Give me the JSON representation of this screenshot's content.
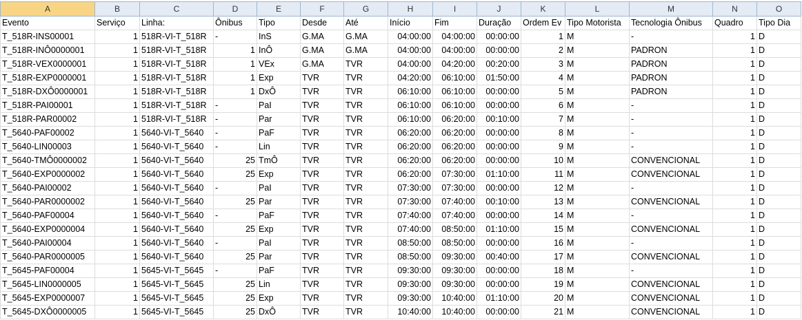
{
  "columns": [
    "A",
    "B",
    "C",
    "D",
    "E",
    "F",
    "G",
    "H",
    "I",
    "J",
    "K",
    "L",
    "M",
    "N",
    "O"
  ],
  "selected_column": "A",
  "header_row": [
    "Evento",
    "Serviço",
    "Linha:",
    "Ônibus",
    "Tipo",
    "Desde",
    "Até",
    "Início",
    "Fim",
    "Duração",
    "Ordem Ev",
    "Tipo Motorista",
    "Tecnologia Ônibus",
    "Quadro",
    "Tipo Dia"
  ],
  "rows": [
    [
      "T_518R-INS00001",
      "1",
      "518R-VI-T_518R",
      "-",
      "InS",
      "G.MA",
      "G.MA",
      "04:00:00",
      "04:00:00",
      "00:00:00",
      "1",
      "M",
      "-",
      "1",
      "D"
    ],
    [
      "T_518R-INÔ0000001",
      "1",
      "518R-VI-T_518R",
      "1",
      "InÔ",
      "G.MA",
      "G.MA",
      "04:00:00",
      "04:00:00",
      "00:00:00",
      "2",
      "M",
      "PADRON",
      "1",
      "D"
    ],
    [
      "T_518R-VEX0000001",
      "1",
      "518R-VI-T_518R",
      "1",
      "VEx",
      "G.MA",
      "TVR",
      "04:00:00",
      "04:20:00",
      "00:20:00",
      "3",
      "M",
      "PADRON",
      "1",
      "D"
    ],
    [
      "T_518R-EXP0000001",
      "1",
      "518R-VI-T_518R",
      "1",
      "Exp",
      "TVR",
      "TVR",
      "04:20:00",
      "06:10:00",
      "01:50:00",
      "4",
      "M",
      "PADRON",
      "1",
      "D"
    ],
    [
      "T_518R-DXÔ0000001",
      "1",
      "518R-VI-T_518R",
      "1",
      "DxÔ",
      "TVR",
      "TVR",
      "06:10:00",
      "06:10:00",
      "00:00:00",
      "5",
      "M",
      "PADRON",
      "1",
      "D"
    ],
    [
      "T_518R-PAI00001",
      "1",
      "518R-VI-T_518R",
      "-",
      "PaI",
      "TVR",
      "TVR",
      "06:10:00",
      "06:10:00",
      "00:00:00",
      "6",
      "M",
      "-",
      "1",
      "D"
    ],
    [
      "T_518R-PAR00002",
      "1",
      "518R-VI-T_518R",
      "-",
      "Par",
      "TVR",
      "TVR",
      "06:10:00",
      "06:20:00",
      "00:10:00",
      "7",
      "M",
      "-",
      "1",
      "D"
    ],
    [
      "T_5640-PAF00002",
      "1",
      "5640-VI-T_5640",
      "-",
      "PaF",
      "TVR",
      "TVR",
      "06:20:00",
      "06:20:00",
      "00:00:00",
      "8",
      "M",
      "-",
      "1",
      "D"
    ],
    [
      "T_5640-LIN00003",
      "1",
      "5640-VI-T_5640",
      "-",
      "Lin",
      "TVR",
      "TVR",
      "06:20:00",
      "06:20:00",
      "00:00:00",
      "9",
      "M",
      "-",
      "1",
      "D"
    ],
    [
      "T_5640-TMÔ0000002",
      "1",
      "5640-VI-T_5640",
      "25",
      "TmÔ",
      "TVR",
      "TVR",
      "06:20:00",
      "06:20:00",
      "00:00:00",
      "10",
      "M",
      "CONVENCIONAL",
      "1",
      "D"
    ],
    [
      "T_5640-EXP0000002",
      "1",
      "5640-VI-T_5640",
      "25",
      "Exp",
      "TVR",
      "TVR",
      "06:20:00",
      "07:30:00",
      "01:10:00",
      "11",
      "M",
      "CONVENCIONAL",
      "1",
      "D"
    ],
    [
      "T_5640-PAI00002",
      "1",
      "5640-VI-T_5640",
      "-",
      "PaI",
      "TVR",
      "TVR",
      "07:30:00",
      "07:30:00",
      "00:00:00",
      "12",
      "M",
      "-",
      "1",
      "D"
    ],
    [
      "T_5640-PAR0000002",
      "1",
      "5640-VI-T_5640",
      "25",
      "Par",
      "TVR",
      "TVR",
      "07:30:00",
      "07:40:00",
      "00:10:00",
      "13",
      "M",
      "CONVENCIONAL",
      "1",
      "D"
    ],
    [
      "T_5640-PAF00004",
      "1",
      "5640-VI-T_5640",
      "-",
      "PaF",
      "TVR",
      "TVR",
      "07:40:00",
      "07:40:00",
      "00:00:00",
      "14",
      "M",
      "-",
      "1",
      "D"
    ],
    [
      "T_5640-EXP0000004",
      "1",
      "5640-VI-T_5640",
      "25",
      "Exp",
      "TVR",
      "TVR",
      "07:40:00",
      "08:50:00",
      "01:10:00",
      "15",
      "M",
      "CONVENCIONAL",
      "1",
      "D"
    ],
    [
      "T_5640-PAI00004",
      "1",
      "5640-VI-T_5640",
      "-",
      "PaI",
      "TVR",
      "TVR",
      "08:50:00",
      "08:50:00",
      "00:00:00",
      "16",
      "M",
      "-",
      "1",
      "D"
    ],
    [
      "T_5640-PAR0000005",
      "1",
      "5640-VI-T_5640",
      "25",
      "Par",
      "TVR",
      "TVR",
      "08:50:00",
      "09:30:00",
      "00:40:00",
      "17",
      "M",
      "CONVENCIONAL",
      "1",
      "D"
    ],
    [
      "T_5645-PAF00004",
      "1",
      "5645-VI-T_5645",
      "-",
      "PaF",
      "TVR",
      "TVR",
      "09:30:00",
      "09:30:00",
      "00:00:00",
      "18",
      "M",
      "-",
      "1",
      "D"
    ],
    [
      "T_5645-LIN0000005",
      "1",
      "5645-VI-T_5645",
      "25",
      "Lin",
      "TVR",
      "TVR",
      "09:30:00",
      "09:30:00",
      "00:00:00",
      "19",
      "M",
      "CONVENCIONAL",
      "1",
      "D"
    ],
    [
      "T_5645-EXP0000007",
      "1",
      "5645-VI-T_5645",
      "25",
      "Exp",
      "TVR",
      "TVR",
      "09:30:00",
      "10:40:00",
      "01:10:00",
      "20",
      "M",
      "CONVENCIONAL",
      "1",
      "D"
    ],
    [
      "T_5645-DXÔ0000005",
      "1",
      "5645-VI-T_5645",
      "25",
      "DxÔ",
      "TVR",
      "TVR",
      "10:40:00",
      "10:40:00",
      "00:00:00",
      "21",
      "M",
      "CONVENCIONAL",
      "1",
      "D"
    ]
  ]
}
